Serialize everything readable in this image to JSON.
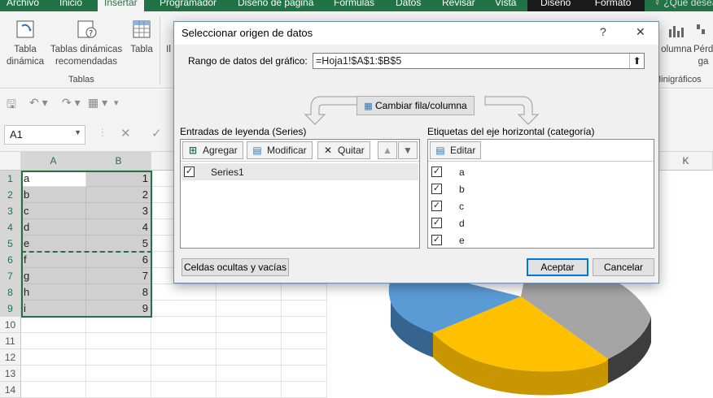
{
  "ribbon": {
    "tabs": [
      "Archivo",
      "Inicio",
      "Insertar",
      "Programador",
      "Diseño de página",
      "Fórmulas",
      "Datos",
      "Revisar",
      "Vista",
      "Diseño",
      "Formato"
    ],
    "tell_me": "¿Qué desea",
    "buttons": {
      "tabla_dinamica": "Tabla\ndinámica",
      "tablas_recomendadas": "Tablas dinámicas\nrecomendadas",
      "tabla": "Tabla",
      "il": "Il",
      "columna": "olumna",
      "perdidas": "Pérd\nga"
    },
    "group_tablas": "Tablas",
    "group_minigraficos": "Minigráficos"
  },
  "formula_bar": {
    "name_box": "A1"
  },
  "grid": {
    "columns": [
      "A",
      "B",
      "K"
    ],
    "rows": [
      {
        "n": "1",
        "a": "a",
        "b": "1"
      },
      {
        "n": "2",
        "a": "b",
        "b": "2"
      },
      {
        "n": "3",
        "a": "c",
        "b": "3"
      },
      {
        "n": "4",
        "a": "d",
        "b": "4"
      },
      {
        "n": "5",
        "a": "e",
        "b": "5"
      },
      {
        "n": "6",
        "a": "f",
        "b": "6"
      },
      {
        "n": "7",
        "a": "g",
        "b": "7"
      },
      {
        "n": "8",
        "a": "h",
        "b": "8"
      },
      {
        "n": "9",
        "a": "i",
        "b": "9"
      },
      {
        "n": "10",
        "a": "",
        "b": ""
      },
      {
        "n": "11",
        "a": "",
        "b": ""
      },
      {
        "n": "12",
        "a": "",
        "b": ""
      },
      {
        "n": "13",
        "a": "",
        "b": ""
      },
      {
        "n": "14",
        "a": "",
        "b": ""
      }
    ]
  },
  "chart": {
    "type": "pie-3d",
    "colors": [
      "#5b9bd5",
      "#ed7d31",
      "#a5a5a5",
      "#ffc000"
    ]
  },
  "dialog": {
    "title": "Seleccionar origen de datos",
    "help": "?",
    "close": "✕",
    "range_label": "Rango de datos del gráfico:",
    "range_value": "=Hoja1!$A$1:$B$5",
    "switch_button": "Cambiar fila/columna",
    "legend_header": "Entradas de leyenda (Series)",
    "axis_header": "Etiquetas del eje horizontal (categoría)",
    "add": "Agregar",
    "edit": "Modificar",
    "remove": "Quitar",
    "edit_axis": "Editar",
    "series": [
      "Series1"
    ],
    "categories": [
      "a",
      "b",
      "c",
      "d",
      "e"
    ],
    "hidden_cells": "Celdas ocultas y vacías",
    "ok": "Aceptar",
    "cancel": "Cancelar"
  }
}
